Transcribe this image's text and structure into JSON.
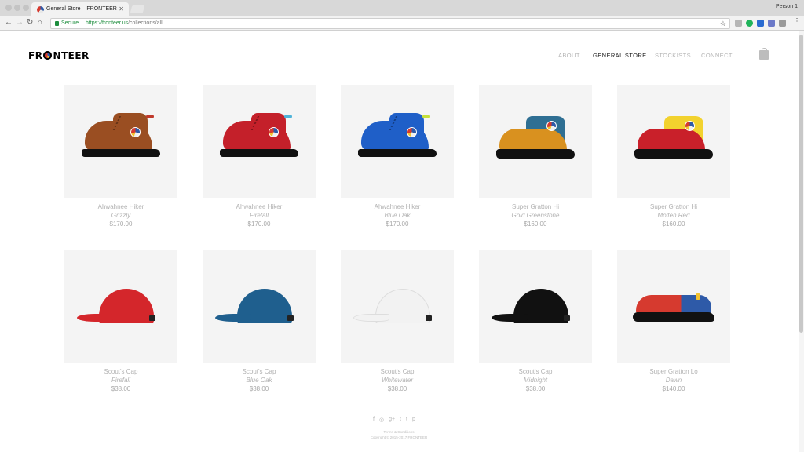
{
  "browser": {
    "tab_title": "General Store – FRONTEER",
    "tab_close": "✕",
    "profile": "Person 1",
    "secure_label": "Secure",
    "url_host": "https://fronteer.us",
    "url_path": "/collections/all"
  },
  "site": {
    "logo_left": "FR",
    "logo_right": "NTEER",
    "nav": [
      "ABOUT",
      "GENERAL STORE",
      "STOCKISTS",
      "CONNECT"
    ],
    "active_nav": "GENERAL STORE"
  },
  "products": [
    {
      "name": "Ahwahnee Hiker",
      "variant": "Grizzly",
      "price": "$170.00",
      "kind": "boot",
      "color": "#9a4e22",
      "accent": "#c0392b"
    },
    {
      "name": "Ahwahnee Hiker",
      "variant": "Firefall",
      "price": "$170.00",
      "kind": "boot",
      "color": "#c4202a",
      "accent": "#4fb3d9"
    },
    {
      "name": "Ahwahnee Hiker",
      "variant": "Blue Oak",
      "price": "$170.00",
      "kind": "boot",
      "color": "#1f5fc8",
      "accent": "#c6e03a"
    },
    {
      "name": "Super Gratton Hi",
      "variant": "Gold Greenstone",
      "price": "$160.00",
      "kind": "hi",
      "color": "#d9911f",
      "accent": "#2f6f93"
    },
    {
      "name": "Super Gratton Hi",
      "variant": "Molten Red",
      "price": "$160.00",
      "kind": "hi",
      "color": "#c9202a",
      "accent": "#f2d22e"
    },
    {
      "name": "Scout's Cap",
      "variant": "Firefall",
      "price": "$38.00",
      "kind": "cap",
      "color": "#d4262b"
    },
    {
      "name": "Scout's Cap",
      "variant": "Blue Oak",
      "price": "$38.00",
      "kind": "cap",
      "color": "#1f5f8e"
    },
    {
      "name": "Scout's Cap",
      "variant": "Whitewater",
      "price": "$38.00",
      "kind": "cap",
      "color": "#f2f2f2"
    },
    {
      "name": "Scout's Cap",
      "variant": "Midnight",
      "price": "$38.00",
      "kind": "cap",
      "color": "#111111"
    },
    {
      "name": "Super Gratton Lo",
      "variant": "Dawn",
      "price": "$140.00",
      "kind": "lo",
      "color": "#d63a2f"
    }
  ],
  "footer": {
    "social": [
      "f",
      "◎",
      "g+",
      "t",
      "t",
      "p"
    ],
    "terms": "Terms & Conditions",
    "copyright": "Copyright © 2015-2017 FRONTEER"
  }
}
